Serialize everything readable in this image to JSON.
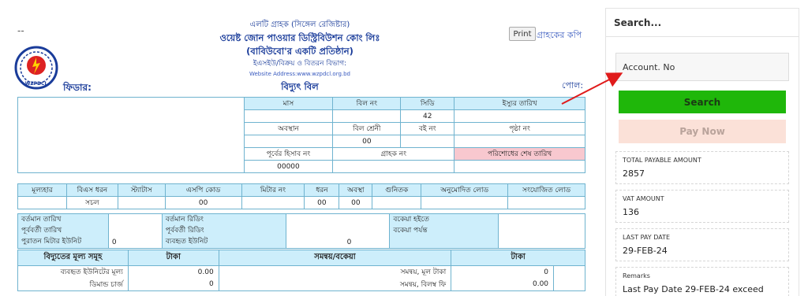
{
  "bill": {
    "dash": "--",
    "header": {
      "line1": "এলটি গ্রাহক (সিঙ্গেল রেজিষ্টার)",
      "line2": "ওয়েষ্ট জোন পাওয়ার ডিস্ট্রিবিউশন কোং লিঃ",
      "line3": "(বাবিউবো'র একটি প্রতিষ্ঠান)",
      "line4": "ইএসইউ/বিক্রয় ও বিতরন বিভাগ:",
      "website": "Website Address:www.wzpdcl.org.bd",
      "title": "বিদ্যুৎ বিল",
      "feeder_label": "ফিডার:",
      "pole_label": "পোল:"
    },
    "logo_text": "WZPDCL",
    "print_label": "Print",
    "copy_label": "গ্রাহকের কপি",
    "info_table": {
      "row1": [
        "মাস",
        "বিল নং",
        "সিডি",
        "ইস্যুর তারিখ"
      ],
      "row1_values": [
        "",
        "",
        "42",
        ""
      ],
      "row2": [
        "অবস্থান",
        "বিল শ্রেনী",
        "বই নং",
        "পৃষ্ঠা নং"
      ],
      "row2_values": [
        "",
        "00",
        "",
        ""
      ],
      "row3": [
        "পূর্বের হিসাব নং",
        "গ্রাহক নং",
        "পরিশোধের শেষ তারিখ"
      ],
      "row3_values": [
        "00000",
        "",
        ""
      ]
    },
    "meter_table": {
      "headers": [
        "মূল্যহার",
        "বিএস ধরন",
        "স্ট্যাটাস",
        "এসপি কোড",
        "মিটার নং",
        "ধরন",
        "অবস্থা",
        "গুনিতক",
        "অনুমোদিত লোড",
        "সংযোজিত লোড"
      ],
      "values": [
        "",
        "সচল",
        "",
        "00",
        "",
        "00",
        "00",
        "",
        "",
        ""
      ]
    },
    "reading_table": {
      "left_labels": [
        "বর্তমান তারিখ",
        "পূর্ববর্তী তারিখ",
        "পুরাতন মিটার ইউনিট"
      ],
      "left_value": "0",
      "mid_labels": [
        "বর্তমান রিডিং",
        "পূর্ববর্তী রিডিং",
        "ব্যবহৃত ইউনিট"
      ],
      "mid_value": "0",
      "right_labels": [
        "বকেয়া হইতে",
        "বকেয়া পর্যন্ত"
      ]
    },
    "charges_table": {
      "headers": [
        "বিদ্যুতের মূল্য সমূহ",
        "টাকা",
        "সমন্বয়/বকেয়া",
        "টাকা"
      ],
      "rows": [
        {
          "label": "ব্যবহৃত ইউনিটের মূল্য",
          "amount": "0.00",
          "adj_label": "সমন্বয়, মূল টাকা",
          "adj_amount": "0"
        },
        {
          "label": "ডিমান্ড চার্জ",
          "amount": "0",
          "adj_label": "সমন্বয়, বিলম্ব ফি",
          "adj_amount": "0.00"
        }
      ]
    }
  },
  "panel": {
    "title": "Search...",
    "account_placeholder": "Account. No",
    "search_label": "Search",
    "pay_label": "Pay Now",
    "cards": [
      {
        "label": "TOTAL PAYABLE AMOUNT",
        "value": "2857"
      },
      {
        "label": "VAT AMOUNT",
        "value": "136"
      },
      {
        "label": "LAST PAY DATE",
        "value": "29-FEB-24"
      },
      {
        "label": "Remarks",
        "value": "Last Pay Date 29-FEB-24 exceed"
      }
    ]
  },
  "colors": {
    "search_button": "#1fb70a",
    "pay_button": "#fbe1d8",
    "table_header": "#cdeefb",
    "due_date_highlight": "#f8c8cf",
    "arrow": "#e01b1b"
  }
}
